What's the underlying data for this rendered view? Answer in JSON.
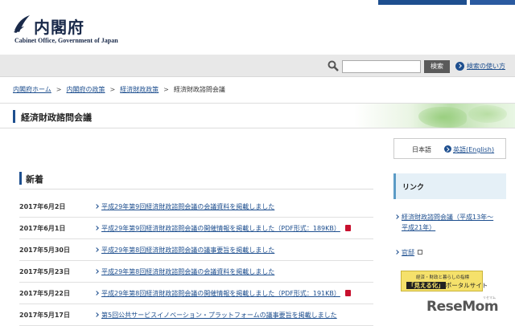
{
  "header": {
    "logo_jp": "内閣府",
    "logo_en": "Cabinet Office, Government of Japan",
    "brand_color": "#1e4f8f"
  },
  "search": {
    "placeholder": "",
    "button_label": "検索",
    "help_link": "検索の使い方"
  },
  "breadcrumb": {
    "items": [
      "内閣府ホーム",
      "内閣府の政策",
      "経済財政政策"
    ],
    "current": "経済財政諮問会議"
  },
  "page_title": "経済財政諮問会議",
  "language": {
    "current": "日本語",
    "english": "英語(English)"
  },
  "news": {
    "heading": "新着",
    "items": [
      {
        "date": "2017年6月2日",
        "text": "平成29年第9回経済財政諮問会議の会議資料を掲載しました",
        "pdf": false
      },
      {
        "date": "2017年6月1日",
        "text": "平成29年第9回経済財政諮問会議の開催情報を掲載しました（PDF形式：189KB）",
        "pdf": true
      },
      {
        "date": "2017年5月30日",
        "text": "平成29年第8回経済財政諮問会議の議事要旨を掲載しました",
        "pdf": false
      },
      {
        "date": "2017年5月23日",
        "text": "平成29年第8回経済財政諮問会議の会議資料を掲載しました",
        "pdf": false
      },
      {
        "date": "2017年5月22日",
        "text": "平成29年第8回経済財政諮問会議の開催情報を掲載しました（PDF形式：191KB）",
        "pdf": true
      },
      {
        "date": "2017年5月17日",
        "text": "第5回公共サービスイノベーション・プラットフォームの議事要旨を掲載しました",
        "pdf": false
      }
    ]
  },
  "sidebar": {
    "links_heading": "リンク",
    "link1_a": "経済財政諮問会議（平成13年〜",
    "link1_b": "平成21年）",
    "link2": "官邸",
    "banner_line1": "経済・財政と暮らしの指標",
    "banner_highlight": "「見える化」",
    "banner_line2": "ポータルサイト"
  },
  "watermark": {
    "text": "ReseMom",
    "sub": "リセマム"
  }
}
